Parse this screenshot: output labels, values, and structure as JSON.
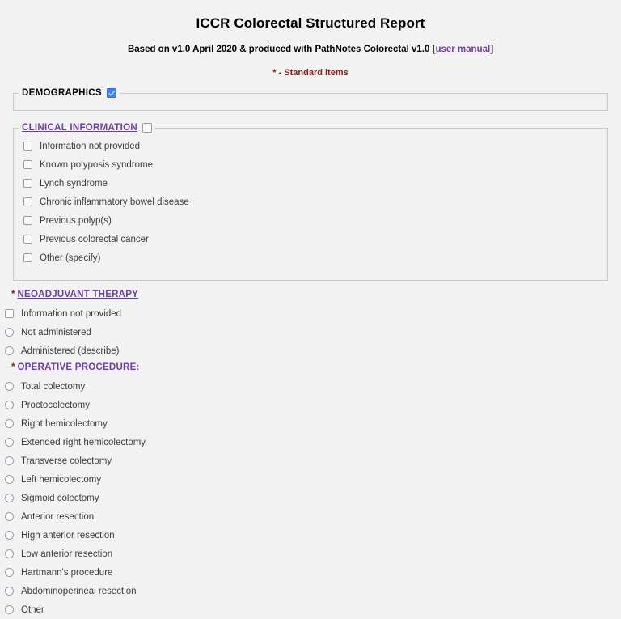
{
  "header": {
    "title": "ICCR Colorectal Structured Report",
    "subtitle_prefix": "Based on v1.0 April 2020 & produced with PathNotes Colorectal v1.0 [",
    "subtitle_link": "user manual",
    "subtitle_suffix": "]",
    "standard_items_note": "* - Standard items"
  },
  "demographics": {
    "legend": "DEMOGRAPHICS",
    "checkbox_checked": true
  },
  "clinical_information": {
    "legend": "CLINICAL INFORMATION",
    "checkbox_checked": false,
    "options": [
      {
        "label": "Information not provided",
        "type": "checkbox",
        "checked": false
      },
      {
        "label": "Known polyposis syndrome",
        "type": "checkbox",
        "checked": false
      },
      {
        "label": "Lynch syndrome",
        "type": "checkbox",
        "checked": false
      },
      {
        "label": "Chronic inflammatory bowel disease",
        "type": "checkbox",
        "checked": false
      },
      {
        "label": "Previous polyp(s)",
        "type": "checkbox",
        "checked": false
      },
      {
        "label": "Previous colorectal cancer",
        "type": "checkbox",
        "checked": false
      },
      {
        "label": "Other (specify)",
        "type": "checkbox",
        "checked": false
      }
    ]
  },
  "neoadjuvant_therapy": {
    "star": "*",
    "heading": "NEOADJUVANT THERAPY",
    "options": [
      {
        "label": "Information not provided",
        "type": "checkbox",
        "checked": false
      },
      {
        "label": "Not administered",
        "type": "radio",
        "checked": false
      },
      {
        "label": "Administered (describe)",
        "type": "radio",
        "checked": false
      }
    ]
  },
  "operative_procedure": {
    "star": "*",
    "heading": "OPERATIVE PROCEDURE:",
    "options": [
      {
        "label": "Total colectomy",
        "type": "radio",
        "checked": false
      },
      {
        "label": "Proctocolectomy",
        "type": "radio",
        "checked": false
      },
      {
        "label": "Right hemicolectomy",
        "type": "radio",
        "checked": false
      },
      {
        "label": "Extended right hemicolectomy",
        "type": "radio",
        "checked": false
      },
      {
        "label": "Transverse colectomy",
        "type": "radio",
        "checked": false
      },
      {
        "label": "Left hemicolectomy",
        "type": "radio",
        "checked": false
      },
      {
        "label": "Sigmoid colectomy",
        "type": "radio",
        "checked": false
      },
      {
        "label": "Anterior resection",
        "type": "radio",
        "checked": false
      },
      {
        "label": "High anterior resection",
        "type": "radio",
        "checked": false
      },
      {
        "label": "Low anterior resection",
        "type": "radio",
        "checked": false
      },
      {
        "label": "Hartmann's procedure",
        "type": "radio",
        "checked": false
      },
      {
        "label": "Abdominoperineal resection",
        "type": "radio",
        "checked": false
      },
      {
        "label": "Other",
        "type": "radio",
        "checked": false
      }
    ]
  },
  "colors": {
    "background": "#f2f2f2",
    "heading_purple": "#6b3fa0",
    "standard_red": "#8b1a1a",
    "checkbox_checked_blue": "#3b82f6",
    "border_gray": "#c9c9c9"
  }
}
